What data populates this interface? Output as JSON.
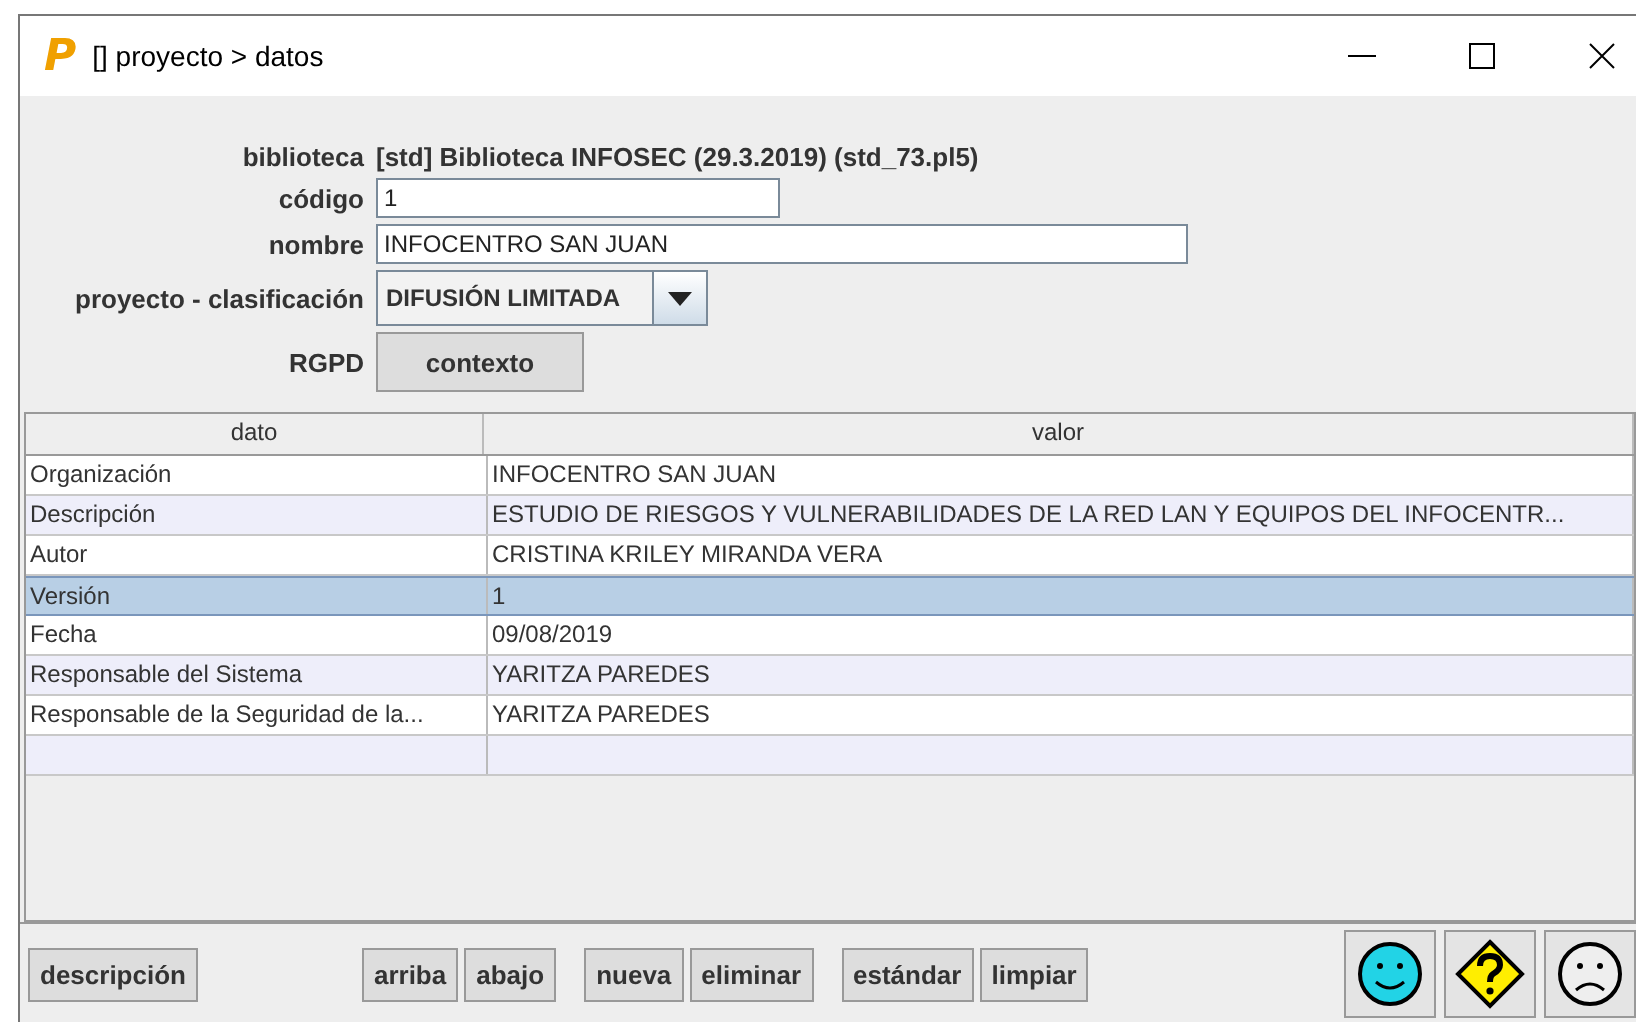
{
  "window": {
    "logo": "P",
    "title": "[] proyecto > datos"
  },
  "form": {
    "biblioteca_label": "biblioteca",
    "biblioteca": "[std] Biblioteca INFOSEC (29.3.2019) (std_73.pl5)",
    "codigo_label": "código",
    "codigo": "1",
    "nombre_label": "nombre",
    "nombre": "INFOCENTRO SAN JUAN",
    "clasificacion_label": "proyecto - clasificación",
    "clasificacion": "DIFUSIÓN LIMITADA",
    "rgpd_label": "RGPD",
    "rgpd_button": "contexto"
  },
  "table": {
    "columns": [
      "dato",
      "valor"
    ],
    "rows": [
      {
        "dato": "Organización",
        "valor": "INFOCENTRO SAN JUAN",
        "selected": false
      },
      {
        "dato": "Descripción",
        "valor": "ESTUDIO DE RIESGOS Y VULNERABILIDADES DE LA RED LAN Y EQUIPOS DEL INFOCENTR...",
        "selected": false
      },
      {
        "dato": "Autor",
        "valor": "CRISTINA KRILEY MIRANDA VERA",
        "selected": false
      },
      {
        "dato": "Versión",
        "valor": "1",
        "selected": true
      },
      {
        "dato": "Fecha",
        "valor": "09/08/2019",
        "selected": false
      },
      {
        "dato": "Responsable del Sistema",
        "valor": "YARITZA PAREDES",
        "selected": false
      },
      {
        "dato": "Responsable de la Seguridad de la...",
        "valor": "YARITZA PAREDES",
        "selected": false
      }
    ]
  },
  "buttons": [
    [
      "descripción"
    ],
    [
      "arriba",
      "abajo"
    ],
    [
      "nueva",
      "eliminar"
    ],
    [
      "estándar",
      "limpiar"
    ]
  ],
  "status_icons": [
    {
      "kind": "happy"
    },
    {
      "kind": "question"
    },
    {
      "kind": "sad"
    }
  ]
}
